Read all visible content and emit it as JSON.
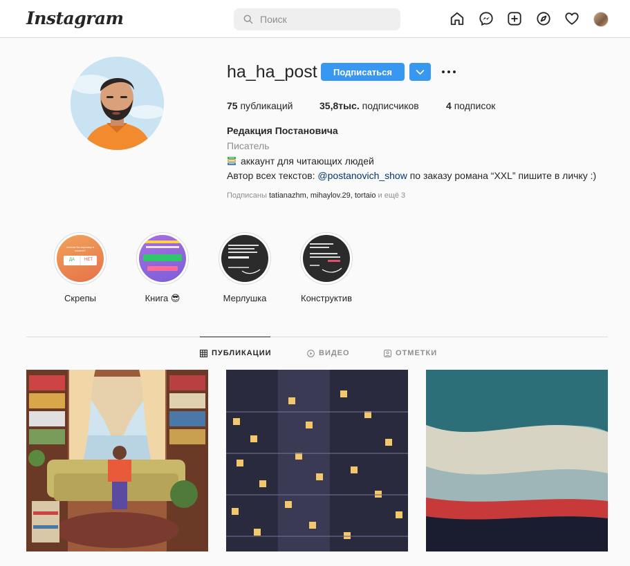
{
  "topbar": {
    "logo": "Instagram",
    "search_placeholder": "Поиск",
    "nav_icons": [
      "home-icon",
      "messenger-icon",
      "new-post-icon",
      "explore-icon",
      "activity-heart-icon",
      "profile-avatar"
    ]
  },
  "profile": {
    "username": "ha_ha_post",
    "follow_label": "Подписаться",
    "stats": {
      "posts_count": "75",
      "posts_label": "публикаций",
      "followers_count": "35,8тыс.",
      "followers_label": "подписчиков",
      "following_count": "4",
      "following_label": "подписок"
    },
    "full_name": "Редакция Постановича",
    "category": "Писатель",
    "bio_line1": "аккаунт для читающих людей",
    "bio_line2_prefix": "Автор всех текстов: ",
    "bio_mention": "@postanovich_show",
    "bio_line2_suffix": " по заказу романа “XXL” пишите в личку :)",
    "followed_by_prefix": "Подписаны ",
    "followed_by_users": "tatianazhm, mihaylov.29, tortaio",
    "followed_by_suffix": " и ещё 3"
  },
  "highlights": [
    {
      "label": "Скрепы",
      "yes": "ДА",
      "no": "НЕТ",
      "q": "Хотели бы картинку в камине?"
    },
    {
      "label": "Книга 😎"
    },
    {
      "label": "Мерлушка"
    },
    {
      "label": "Конструктив"
    }
  ],
  "tabs": [
    {
      "label": "ПУБЛИКАЦИИ",
      "icon": "grid-icon",
      "active": true
    },
    {
      "label": "ВИДЕО",
      "icon": "video-icon",
      "active": false
    },
    {
      "label": "ОТМЕТКИ",
      "icon": "tagged-icon",
      "active": false
    }
  ],
  "colors": {
    "accent": "#3897f0",
    "border": "#dbdbdb",
    "muted": "#8e8e8e",
    "link": "#00376b"
  }
}
